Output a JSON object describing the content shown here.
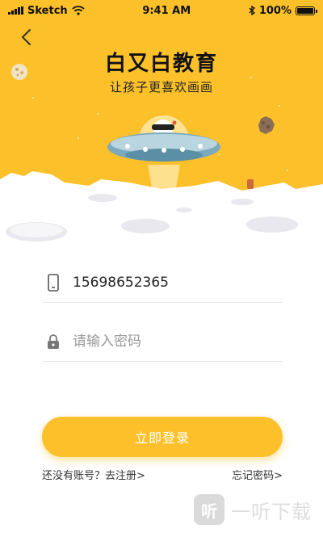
{
  "status_bar": {
    "carrier": "Sketch",
    "time": "9:41 AM",
    "battery": "100%",
    "battery_level": 1.0
  },
  "header": {
    "back_icon": "chevron-left-icon",
    "title": "白又白教育",
    "subtitle": "让孩子更喜欢画画"
  },
  "form": {
    "phone_icon": "phone-icon",
    "phone_value": "15698652365",
    "lock_icon": "lock-icon",
    "password_placeholder": "请输入密码"
  },
  "actions": {
    "login_label": "立即登录",
    "register_link": "还没有账号？去注册>",
    "forgot_link": "忘记密码>"
  },
  "watermark": {
    "badge": "听",
    "text": "一听下载"
  },
  "colors": {
    "accent": "#fcc12a",
    "moon": "#ffffff",
    "ufo_body": "#5a8fa6"
  }
}
